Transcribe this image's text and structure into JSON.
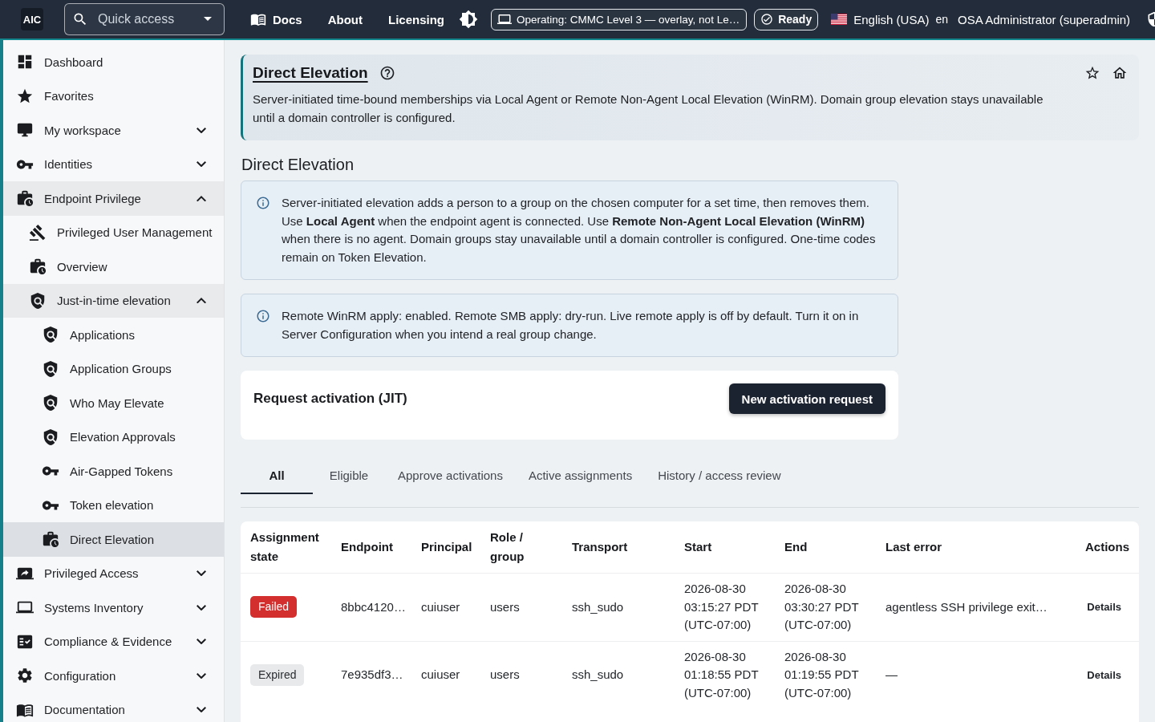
{
  "topbar": {
    "logo": "AIC",
    "search": {
      "placeholder": "Quick access"
    },
    "nav": [
      {
        "label": "Docs"
      },
      {
        "label": "About"
      },
      {
        "label": "Licensing"
      }
    ],
    "mode": "Operating: CMMC Level 3 — overlay, not Le…",
    "status": "Ready",
    "language": {
      "label": "English (USA)",
      "code": "en"
    },
    "user": "OSA Administrator (superadmin)"
  },
  "sidebar": {
    "items": [
      {
        "label": "Dashboard",
        "selected": false
      },
      {
        "label": "Favorites",
        "selected": false
      },
      {
        "label": "My workspace",
        "selected": false,
        "expanded": false
      },
      {
        "label": "Identities",
        "selected": false,
        "expanded": false
      },
      {
        "label": "Endpoint Privilege",
        "selected": false,
        "expanded": true,
        "children": [
          {
            "label": "Privileged User Management",
            "selected": false
          },
          {
            "label": "Overview",
            "selected": false
          },
          {
            "label": "Just-in-time elevation",
            "selected": false,
            "expanded": true,
            "children": [
              {
                "label": "Applications",
                "selected": false
              },
              {
                "label": "Application Groups",
                "selected": false
              },
              {
                "label": "Who May Elevate",
                "selected": false
              },
              {
                "label": "Elevation Approvals",
                "selected": false
              },
              {
                "label": "Air-Gapped Tokens",
                "selected": false
              },
              {
                "label": "Token elevation",
                "selected": false
              },
              {
                "label": "Direct Elevation",
                "selected": true
              }
            ]
          }
        ]
      },
      {
        "label": "Privileged Access",
        "selected": false,
        "expanded": false
      },
      {
        "label": "Systems Inventory",
        "selected": false,
        "expanded": false
      },
      {
        "label": "Compliance & Evidence",
        "selected": false,
        "expanded": false
      },
      {
        "label": "Configuration",
        "selected": false,
        "expanded": false
      },
      {
        "label": "Documentation",
        "selected": false,
        "expanded": false
      }
    ]
  },
  "page_header": {
    "title": "Direct Elevation",
    "description": "Server-initiated time-bound memberships via Local Agent or Remote Non-Agent Local Elevation (WinRM). Domain group elevation stays unavailable until a domain controller is configured."
  },
  "section_title": "Direct Elevation",
  "notices": [
    "Server-initiated elevation adds a person to a group on the chosen computer for a set time, then removes them. Use **Local Agent** when the endpoint agent is connected. Use **Remote Non-Agent Local Elevation (WinRM)** when there is no agent. Domain groups stay unavailable until a domain controller is configured. One-time codes remain on Token Elevation.",
    "Remote WinRM apply: enabled. Remote SMB apply: dry-run. Live remote apply is off by default. Turn it on in Server Configuration when you intend a real group change."
  ],
  "request_card": {
    "title": "Request activation (JIT)",
    "button": "New activation request"
  },
  "tabs": [
    {
      "label": "All",
      "selected": true
    },
    {
      "label": "Eligible",
      "selected": false
    },
    {
      "label": "Approve activations",
      "selected": false
    },
    {
      "label": "Active assignments",
      "selected": false
    },
    {
      "label": "History / access review",
      "selected": false
    }
  ],
  "table": {
    "columns": [
      "Assignment state",
      "Endpoint",
      "Principal",
      "Role / group",
      "Transport",
      "Start",
      "End",
      "Last error",
      "Actions"
    ],
    "rows": [
      {
        "state": {
          "label": "Failed",
          "kind": "error"
        },
        "endpoint": "8bbc4120…",
        "principal": "cuiuser",
        "role_group": "users",
        "transport": "ssh_sudo",
        "start": "2026-08-30 03:15:27 PDT (UTC-07:00)",
        "end": "2026-08-30 03:30:27 PDT (UTC-07:00)",
        "last_error": "agentless SSH privilege exit…",
        "action": "Details"
      },
      {
        "state": {
          "label": "Expired",
          "kind": "neutral"
        },
        "endpoint": "7e935df3…",
        "principal": "cuiuser",
        "role_group": "users",
        "transport": "ssh_sudo",
        "start": "2026-08-30 01:18:55 PDT (UTC-07:00)",
        "end": "2026-08-30 01:19:55 PDT (UTC-07:00)",
        "last_error": "—",
        "action": "Details"
      }
    ]
  }
}
